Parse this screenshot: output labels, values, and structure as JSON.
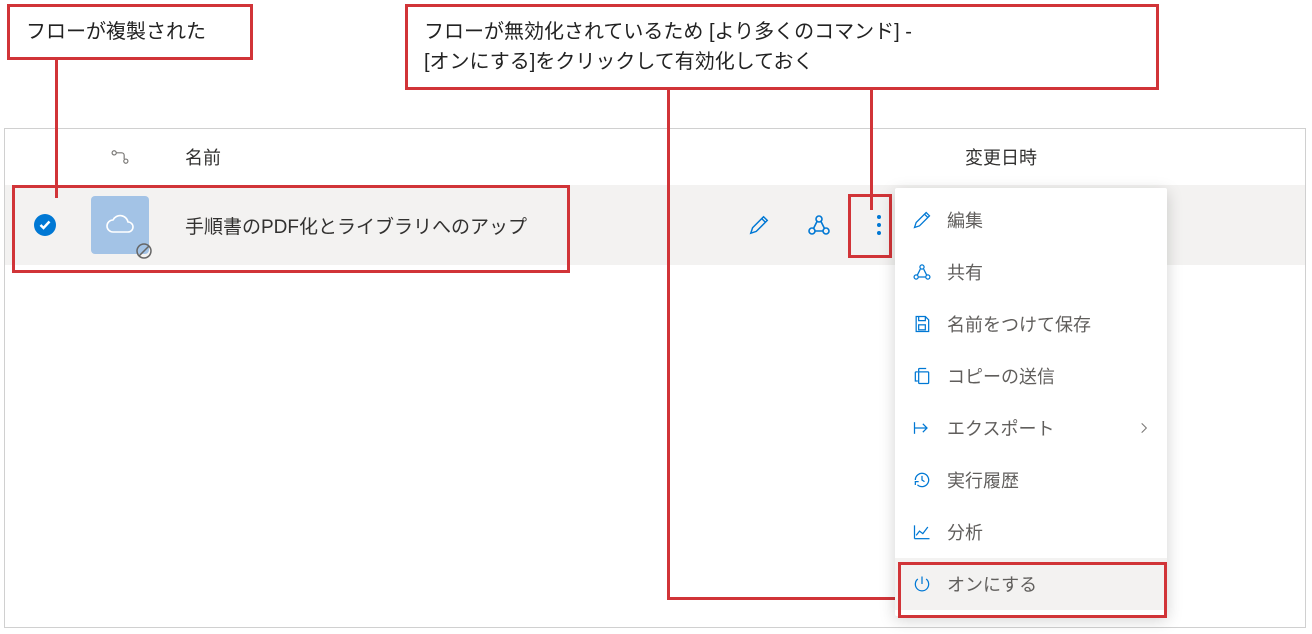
{
  "callouts": {
    "left": "フローが複製された",
    "right_line1": "フローが無効化されているため [より多くのコマンド] -",
    "right_line2": "[オンにする]をクリックして有効化しておく"
  },
  "columns": {
    "name": "名前",
    "modified": "変更日時"
  },
  "flow": {
    "name": "手順書のPDF化とライブラリへのアップ"
  },
  "menu": {
    "edit": "編集",
    "share": "共有",
    "save_as": "名前をつけて保存",
    "send_copy": "コピーの送信",
    "export": "エクスポート",
    "run_history": "実行履歴",
    "analytics": "分析",
    "turn_on": "オンにする"
  }
}
